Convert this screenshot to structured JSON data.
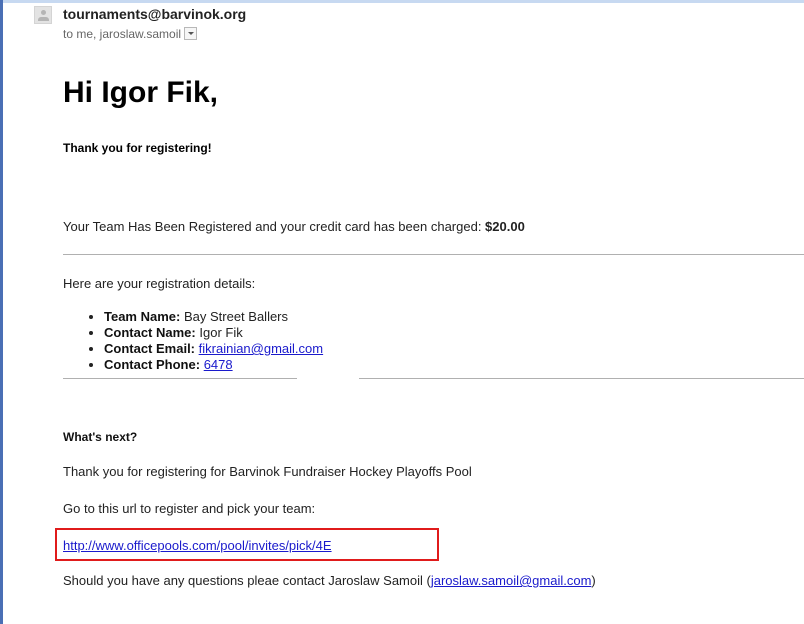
{
  "header": {
    "sender": "tournaments@barvinok.org",
    "recipients": "to me, jaroslaw.samoil"
  },
  "body": {
    "greeting": "Hi Igor Fik,",
    "thanks": "Thank you for registering!",
    "charge_text": "Your Team Has Been Registered and your credit card has been charged: ",
    "charge_amount": "$20.00",
    "details_intro": "Here are your registration details:",
    "details": [
      {
        "label": "Team Name:",
        "value": "Bay Street Ballers"
      },
      {
        "label": "Contact Name:",
        "value": "Igor Fik"
      },
      {
        "label": "Contact Email:",
        "value": "fikrainian@gmail.com"
      },
      {
        "label": "Contact Phone:",
        "value": "6478"
      }
    ],
    "whats_next": "What's next?",
    "pool_text": "Thank you for registering for Barvinok Fundraiser Hockey Playoffs Pool",
    "instruction": "Go to this url to register  and pick your team:",
    "register_link": "http://www.officepools.com/pool/invites/pick/4E",
    "contact_prefix": "Should you have any questions pleae contact Jaroslaw Samoil (",
    "contact_email": "jaroslaw.samoil@gmail.com",
    "contact_suffix": ")"
  },
  "colors": {
    "link": "#1a1acc",
    "highlight": "#e01b1b",
    "left_edge": "#4a6fb5"
  },
  "icons": [
    "default-avatar-icon",
    "chevron-down-icon"
  ]
}
